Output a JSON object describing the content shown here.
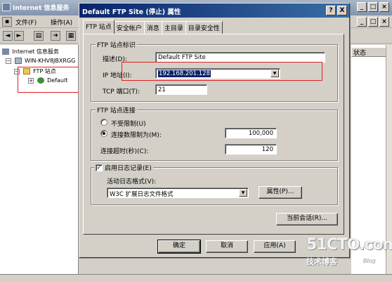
{
  "background_window": {
    "title": "Internet 信息服务",
    "menu": [
      "文件(F)",
      "操作(A)"
    ],
    "tree": {
      "root": "Internet 信息服务",
      "server": "WIN-KHV8JBXRGG",
      "ftp_sites": "FTP 站点",
      "site": "Default"
    },
    "right_column_header": "状态"
  },
  "dialog": {
    "title": "Default FTP Site (停止) 属性",
    "title_buttons": {
      "help": "?",
      "close": "X"
    },
    "tabs": [
      "FTP 站点",
      "安全帐户",
      "消息",
      "主目录",
      "目录安全性"
    ],
    "active_tab": 0,
    "site_id": {
      "legend": "FTP 站点标识",
      "description_label": "描述(D):",
      "description_value": "Default FTP Site",
      "ip_label": "IP 地址(I):",
      "ip_value": "192.168.201.128",
      "port_label": "TCP 端口(T):",
      "port_value": "21"
    },
    "connections": {
      "legend": "FTP 站点连接",
      "unlimited_label": "不受限制(U)",
      "limited_label": "连接数限制为(M):",
      "limit_value": "100,000",
      "selected": "limited",
      "timeout_label": "连接超时(秒)(C):",
      "timeout_value": "120"
    },
    "logging": {
      "enable_label": "启用日志记录(E)",
      "enabled": true,
      "format_label": "活动日志格式(V):",
      "format_value": "W3C 扩展日志文件格式",
      "properties_button": "属性(P)..."
    },
    "current_sessions_button": "当前会话(R)...",
    "footer": {
      "ok": "确定",
      "cancel": "取消",
      "apply": "应用(A)"
    }
  },
  "watermark": {
    "main": "51CTO.com",
    "sub": "技术博客",
    "blog": "Blog"
  }
}
